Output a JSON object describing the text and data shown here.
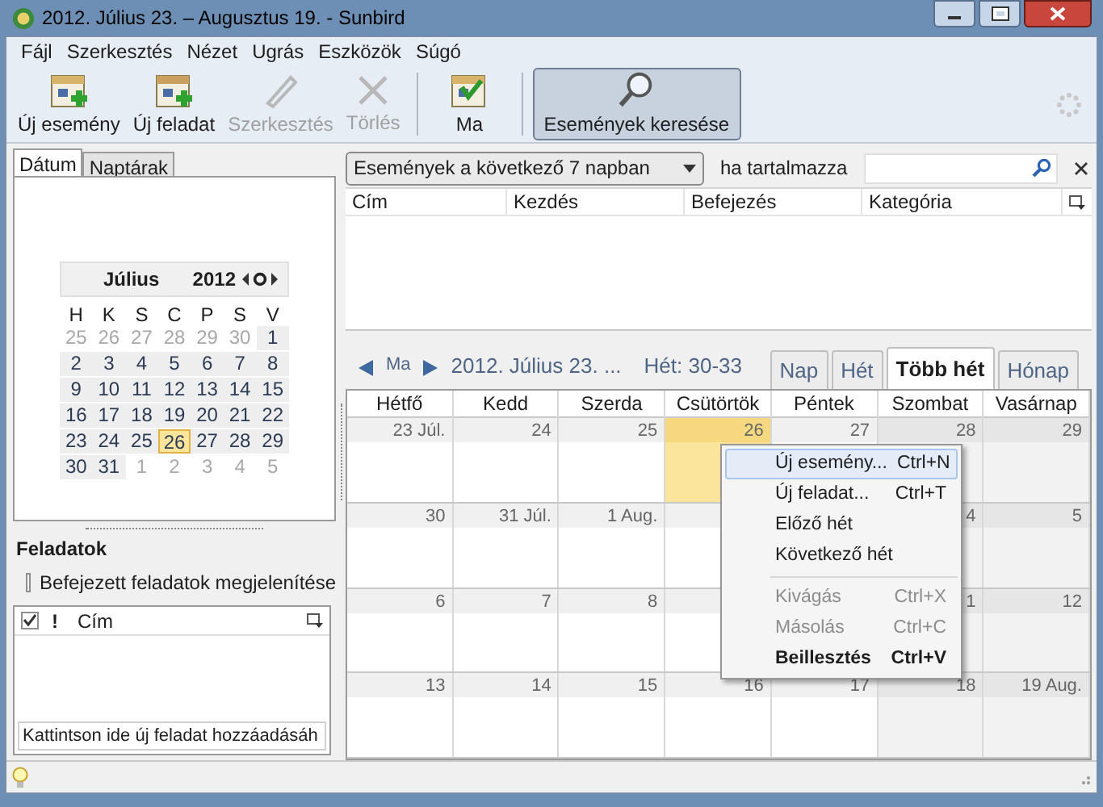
{
  "window": {
    "title": "2012. Július 23. – Augusztus 19. - Sunbird"
  },
  "menu_bar": [
    "Fájl",
    "Szerkesztés",
    "Nézet",
    "Ugrás",
    "Eszközök",
    "Súgó"
  ],
  "toolbar": [
    {
      "kind": "new-event",
      "label": "Új esemény",
      "disabled": false,
      "selected": false
    },
    {
      "kind": "new-task",
      "label": "Új feladat",
      "disabled": false,
      "selected": false
    },
    {
      "kind": "edit",
      "label": "Szerkesztés",
      "disabled": true,
      "selected": false
    },
    {
      "kind": "delete",
      "label": "Törlés",
      "disabled": true,
      "selected": false
    },
    {
      "kind": "today",
      "label": "Ma",
      "disabled": false,
      "selected": false
    },
    {
      "kind": "search",
      "label": "Események keresése",
      "disabled": false,
      "selected": true
    }
  ],
  "left_tabs": [
    {
      "label": "Dátum",
      "selected": true
    },
    {
      "label": "Naptárak",
      "selected": false
    }
  ],
  "mini_calendar": {
    "month": "Július",
    "year": "2012",
    "weekdays": [
      "H",
      "K",
      "S",
      "C",
      "P",
      "S",
      "V"
    ],
    "weeks": [
      [
        {
          "label": "25",
          "other": true,
          "selected": false
        },
        {
          "label": "26",
          "other": true,
          "selected": false
        },
        {
          "label": "27",
          "other": true,
          "selected": false
        },
        {
          "label": "28",
          "other": true,
          "selected": false
        },
        {
          "label": "29",
          "other": true,
          "selected": false
        },
        {
          "label": "30",
          "other": true,
          "selected": false
        },
        {
          "label": "1",
          "other": false,
          "selected": false
        }
      ],
      [
        {
          "label": "2",
          "other": false,
          "selected": false
        },
        {
          "label": "3",
          "other": false,
          "selected": false
        },
        {
          "label": "4",
          "other": false,
          "selected": false
        },
        {
          "label": "5",
          "other": false,
          "selected": false
        },
        {
          "label": "6",
          "other": false,
          "selected": false
        },
        {
          "label": "7",
          "other": false,
          "selected": false
        },
        {
          "label": "8",
          "other": false,
          "selected": false
        }
      ],
      [
        {
          "label": "9",
          "other": false,
          "selected": false
        },
        {
          "label": "10",
          "other": false,
          "selected": false
        },
        {
          "label": "11",
          "other": false,
          "selected": false
        },
        {
          "label": "12",
          "other": false,
          "selected": false
        },
        {
          "label": "13",
          "other": false,
          "selected": false
        },
        {
          "label": "14",
          "other": false,
          "selected": false
        },
        {
          "label": "15",
          "other": false,
          "selected": false
        }
      ],
      [
        {
          "label": "16",
          "other": false,
          "selected": false
        },
        {
          "label": "17",
          "other": false,
          "selected": false
        },
        {
          "label": "18",
          "other": false,
          "selected": false
        },
        {
          "label": "19",
          "other": false,
          "selected": false
        },
        {
          "label": "20",
          "other": false,
          "selected": false
        },
        {
          "label": "21",
          "other": false,
          "selected": false
        },
        {
          "label": "22",
          "other": false,
          "selected": false
        }
      ],
      [
        {
          "label": "23",
          "other": false,
          "selected": false
        },
        {
          "label": "24",
          "other": false,
          "selected": false
        },
        {
          "label": "25",
          "other": false,
          "selected": false
        },
        {
          "label": "26",
          "other": false,
          "selected": true
        },
        {
          "label": "27",
          "other": false,
          "selected": false
        },
        {
          "label": "28",
          "other": false,
          "selected": false
        },
        {
          "label": "29",
          "other": false,
          "selected": false
        }
      ],
      [
        {
          "label": "30",
          "other": false,
          "selected": false
        },
        {
          "label": "31",
          "other": false,
          "selected": false
        },
        {
          "label": "1",
          "other": true,
          "selected": false
        },
        {
          "label": "2",
          "other": true,
          "selected": false
        },
        {
          "label": "3",
          "other": true,
          "selected": false
        },
        {
          "label": "4",
          "other": true,
          "selected": false
        },
        {
          "label": "5",
          "other": true,
          "selected": false
        }
      ]
    ]
  },
  "tasks": {
    "title": "Feladatok",
    "show_completed": {
      "label": "Befejezett feladatok megjelenítése",
      "checked": false
    },
    "columns": [
      "!",
      "Cím"
    ],
    "done_column_checked": true,
    "new_task_placeholder": "Kattintson ide új feladat hozzáadásáh"
  },
  "search_bar": {
    "filter": "Események a következő 7 napban",
    "label": "ha tartalmazza"
  },
  "event_list": {
    "columns": [
      "Cím",
      "Kezdés",
      "Befejezés",
      "Kategória"
    ]
  },
  "navigation": {
    "today": "Ma",
    "range": "2012. Július 23. ...",
    "week": "Hét: 30-33"
  },
  "view_tabs": [
    {
      "label": "Nap",
      "selected": false
    },
    {
      "label": "Hét",
      "selected": false
    },
    {
      "label": "Több hét",
      "selected": true
    },
    {
      "label": "Hónap",
      "selected": false
    }
  ],
  "week_view": {
    "weekdays": [
      "Hétfő",
      "Kedd",
      "Szerda",
      "Csütörtök",
      "Péntek",
      "Szombat",
      "Vasárnap"
    ],
    "rows": [
      [
        {
          "label": "23 Júl.",
          "weekend": false,
          "selected": false
        },
        {
          "label": "24",
          "weekend": false,
          "selected": false
        },
        {
          "label": "25",
          "weekend": false,
          "selected": false
        },
        {
          "label": "26",
          "weekend": false,
          "selected": true
        },
        {
          "label": "27",
          "weekend": false,
          "selected": false
        },
        {
          "label": "28",
          "weekend": true,
          "selected": false
        },
        {
          "label": "29",
          "weekend": true,
          "selected": false
        }
      ],
      [
        {
          "label": "30",
          "weekend": false,
          "selected": false
        },
        {
          "label": "31 Júl.",
          "weekend": false,
          "selected": false
        },
        {
          "label": "1 Aug.",
          "weekend": false,
          "selected": false
        },
        {
          "weekend": false,
          "selected": false
        },
        {},
        {
          "label": "4",
          "weekend": true,
          "selected": false
        },
        {
          "label": "5",
          "weekend": true,
          "selected": false
        }
      ],
      [
        {
          "label": "6",
          "weekend": false,
          "selected": false
        },
        {
          "label": "7",
          "weekend": false,
          "selected": false
        },
        {
          "label": "8",
          "weekend": false,
          "selected": false
        },
        {
          "weekend": false,
          "selected": false
        },
        {},
        {
          "label": "1",
          "weekend": true,
          "selected": false
        },
        {
          "label": "12",
          "weekend": true,
          "selected": false
        }
      ],
      [
        {
          "label": "13",
          "weekend": false,
          "selected": false
        },
        {
          "label": "14",
          "weekend": false,
          "selected": false
        },
        {
          "label": "15",
          "weekend": false,
          "selected": false
        },
        {
          "label": "16",
          "weekend": false,
          "selected": false
        },
        {
          "label": "17",
          "weekend": false,
          "selected": false
        },
        {
          "label": "18",
          "weekend": true,
          "selected": false
        },
        {
          "label": "19 Aug.",
          "weekend": true,
          "selected": false
        }
      ]
    ]
  },
  "context_menu": [
    {
      "kind": "item",
      "label": "Új esemény...",
      "shortcut": "Ctrl+N",
      "selected": true,
      "disabled": false,
      "default": false
    },
    {
      "kind": "item",
      "label": "Új feladat...",
      "shortcut": "Ctrl+T",
      "selected": false,
      "disabled": false,
      "default": false
    },
    {
      "kind": "item",
      "label": "Előző hét",
      "selected": false,
      "disabled": false,
      "default": false
    },
    {
      "kind": "item",
      "label": "Következő hét",
      "selected": false,
      "disabled": false,
      "default": false
    },
    {
      "kind": "separator"
    },
    {
      "kind": "item",
      "label": "Kivágás",
      "shortcut": "Ctrl+X",
      "selected": false,
      "disabled": true,
      "default": false
    },
    {
      "kind": "item",
      "label": "Másolás",
      "shortcut": "Ctrl+C",
      "selected": false,
      "disabled": true,
      "default": false
    },
    {
      "kind": "item",
      "label": "Beillesztés",
      "shortcut": "Ctrl+V",
      "selected": false,
      "disabled": false,
      "default": true
    }
  ]
}
